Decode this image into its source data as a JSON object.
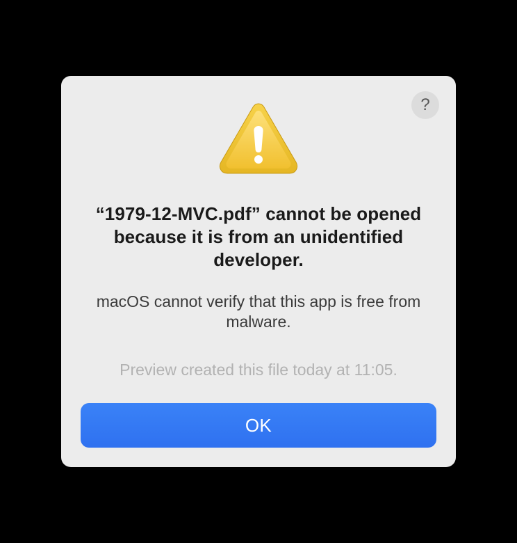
{
  "dialog": {
    "heading": "“1979-12-MVC.pdf” cannot be opened because it is from an unidentified developer.",
    "subtext": "macOS cannot verify that this app is free from malware.",
    "provenance": "Preview created this file today at 11:05.",
    "ok_label": "OK",
    "help_label": "?"
  }
}
